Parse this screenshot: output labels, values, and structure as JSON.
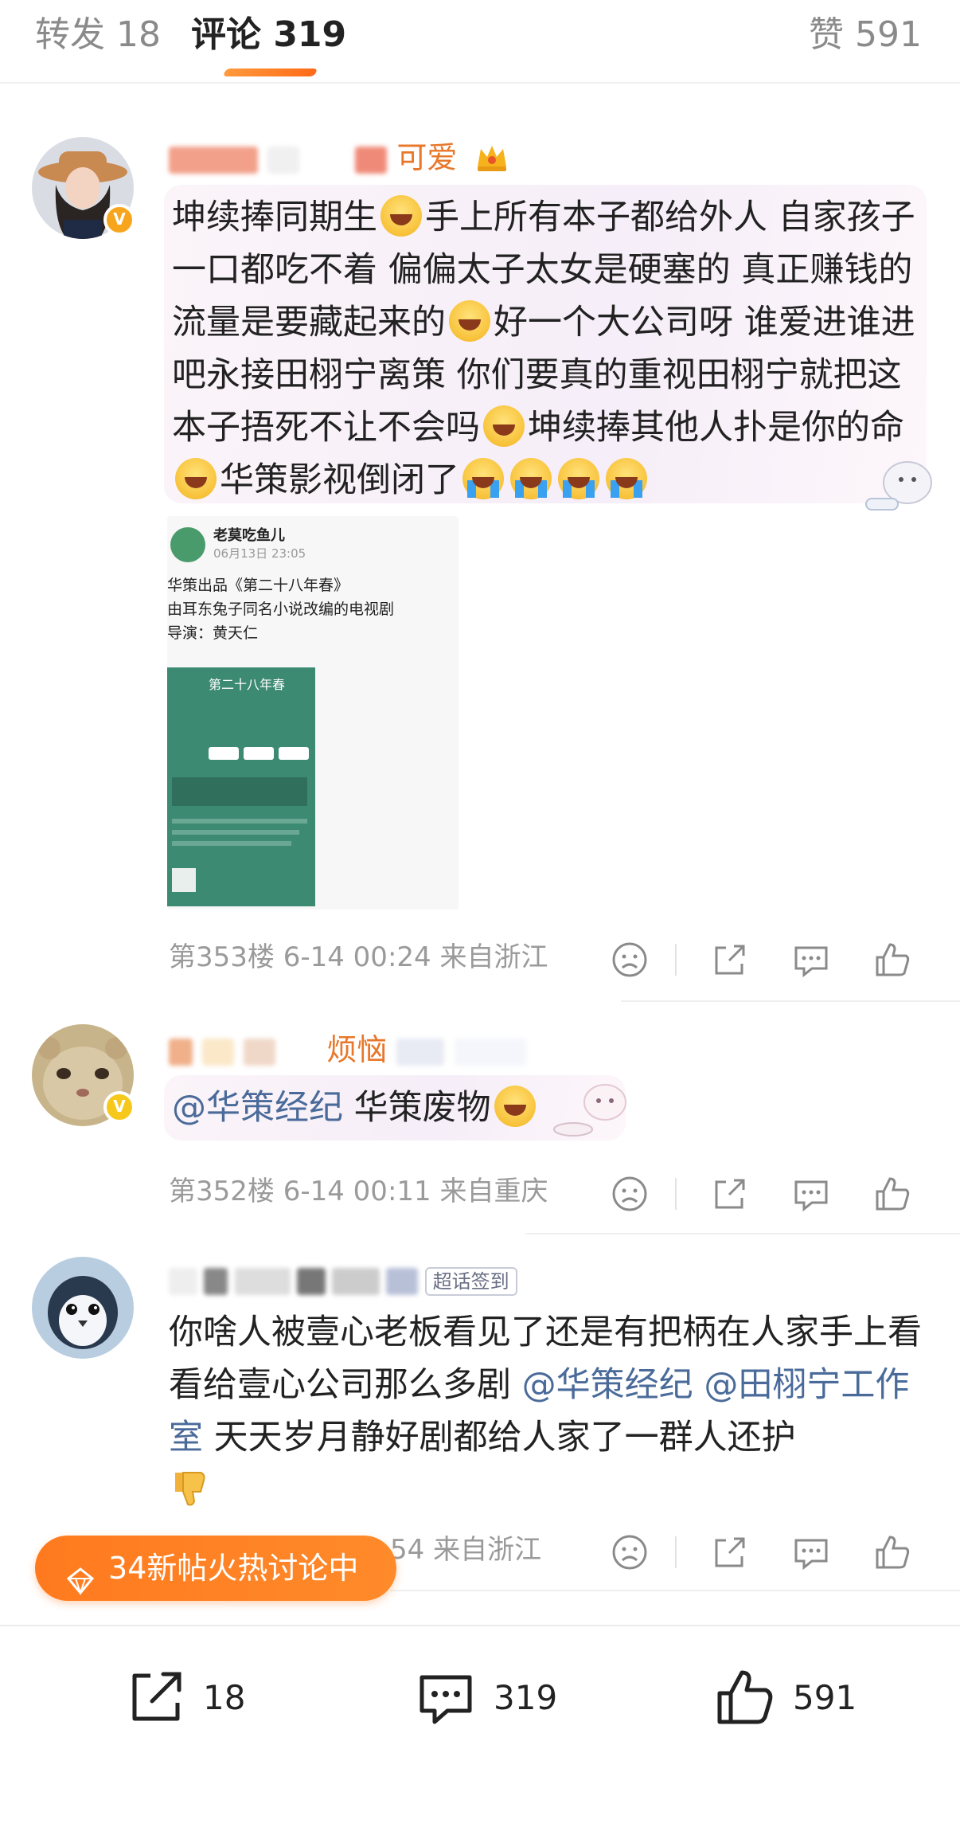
{
  "tabs": {
    "repost_label": "转发 18",
    "comment_label": "评论 319",
    "like_label": "赞 591"
  },
  "comments": [
    {
      "username_visible": "可爱",
      "text_parts": [
        "坤续捧同期生",
        "手上所有本子都给外人 自家孩子一口都吃不着 偏偏太子太女是硬塞的 真正赚钱的流量是要藏起来的",
        "好一个大公司呀 谁爱进谁进吧永接田栩宁离策 你们要真的重视田栩宁就把这本子捂死不让不会吗",
        "坤续捧其他人扑是你的命",
        "华策影视倒闭了"
      ],
      "image": {
        "author": "老莫吃鱼儿",
        "date": "06月13日 23:05",
        "line1": "华策出品《第二十八年春》",
        "line2": "由耳东兔子同名小说改编的电视剧",
        "line3": "导演：黄天仁",
        "card_title": "第二十八年春"
      },
      "meta": "第353楼 6-14 00:24 来自浙江"
    },
    {
      "username_visible": "烦恼",
      "mention": "@华策经纪",
      "text": " 华策废物",
      "meta": "第352楼 6-14 00:11 来自重庆"
    },
    {
      "username_visible": "超话签到",
      "text_a": "你啥人被壹心老板看见了还是有把柄在人家手上看看给壹心公司那么多剧",
      "mention1": "@华策经纪",
      "mention2": "@田栩宁工作室",
      "text_b": "  天天岁月静好剧都给人家了一群人还护",
      "meta": "54 来自浙江"
    }
  ],
  "fire_pill": {
    "label": "34新帖火热讨论中"
  },
  "bottom_bar": {
    "repost_count": "18",
    "comment_count": "319",
    "like_count": "591"
  },
  "icons": {
    "dislike": "frown-icon",
    "share": "share-icon",
    "comment": "comment-icon",
    "like": "thumbs-up-icon"
  },
  "colors": {
    "accent": "#ff7a1e",
    "mention": "#4a6b9a",
    "username": "#e8772a",
    "meta": "#9a9a9a"
  }
}
